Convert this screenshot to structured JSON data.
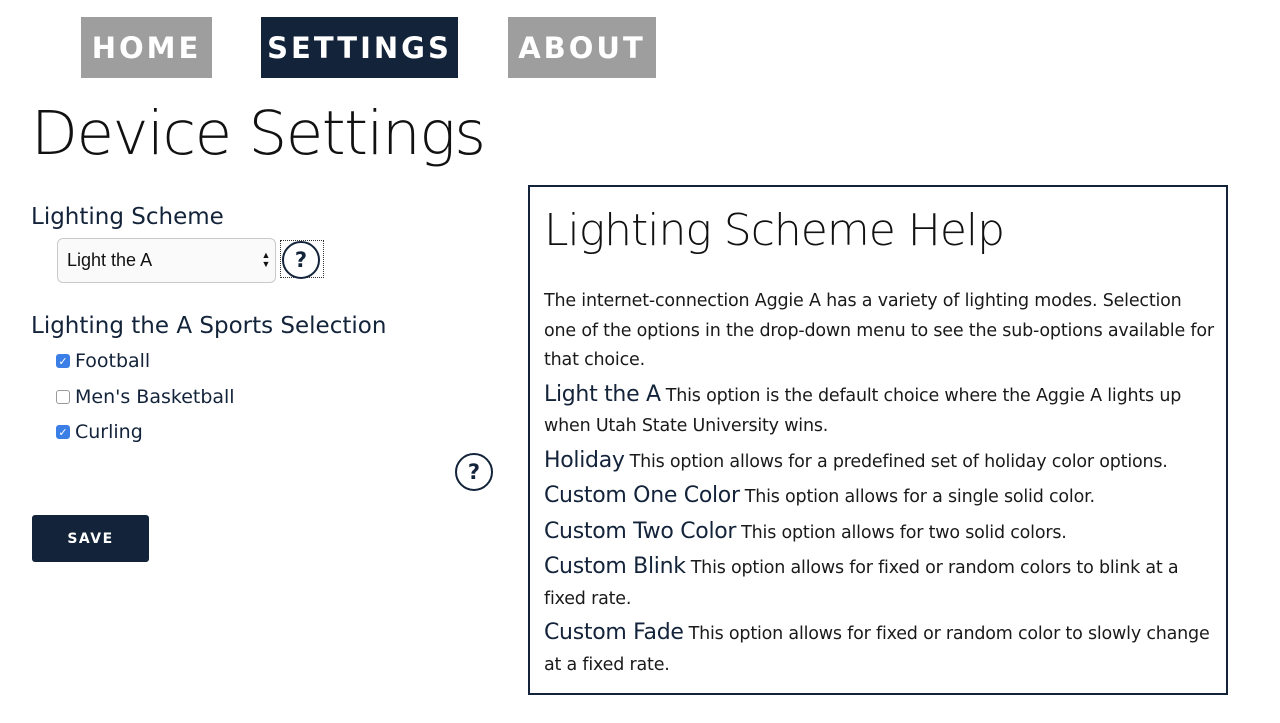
{
  "nav": {
    "items": [
      {
        "label": "HOME"
      },
      {
        "label": "SETTINGS",
        "active": true
      },
      {
        "label": "ABOUT"
      }
    ]
  },
  "page": {
    "title": "Device Settings"
  },
  "lighting_scheme": {
    "heading": "Lighting Scheme",
    "selected": "Light the A",
    "help_label": "?"
  },
  "sports": {
    "heading": "Lighting the A Sports Selection",
    "items": [
      {
        "label": "Football",
        "checked": true
      },
      {
        "label": "Men's Basketball",
        "checked": false
      },
      {
        "label": "Curling",
        "checked": true
      }
    ],
    "help_label": "?"
  },
  "actions": {
    "save_label": "SAVE"
  },
  "help": {
    "title": "Lighting Scheme Help",
    "intro": "The internet-connection Aggie A has a variety of lighting modes. Selection one of the options in the drop-down menu to see the sub-options available for that choice.",
    "items": [
      {
        "term": "Light the A",
        "desc": "This option is the default choice where the Aggie A lights up when Utah State University wins."
      },
      {
        "term": "Holiday",
        "desc": "This option allows for a predefined set of holiday color options."
      },
      {
        "term": "Custom One Color",
        "desc": "This option allows for a single solid color."
      },
      {
        "term": "Custom Two Color",
        "desc": "This option allows for two solid colors."
      },
      {
        "term": "Custom Blink",
        "desc": "This option allows for fixed or random colors to blink at a fixed rate."
      },
      {
        "term": "Custom Fade",
        "desc": "This option allows for fixed or random color to slowly change at a fixed rate."
      }
    ]
  },
  "colors": {
    "navy": "#13233a",
    "nav_inactive": "#9e9e9e",
    "checkbox_accent": "#3b7fe6"
  },
  "icons": {
    "select_arrows": "up-down-arrows-icon",
    "help": "question-mark-icon",
    "checkmark": "check-icon"
  }
}
